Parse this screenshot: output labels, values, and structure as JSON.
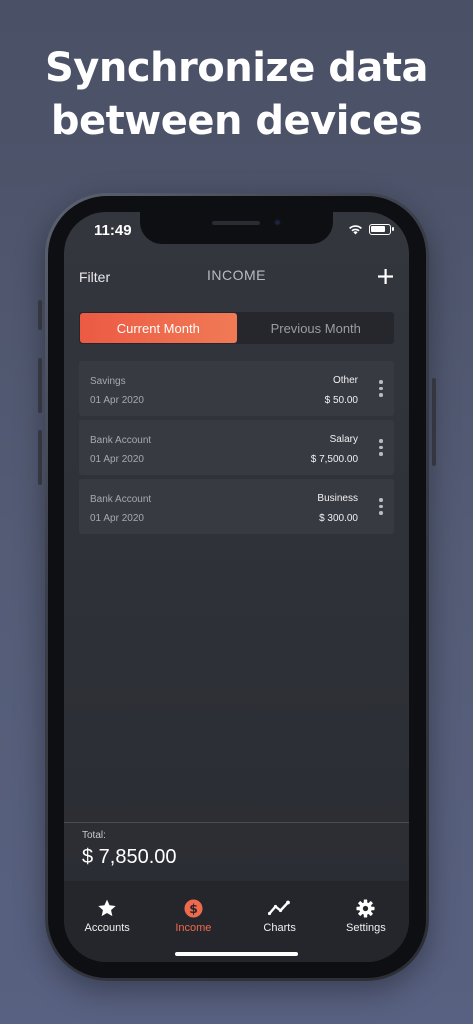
{
  "headline": {
    "line1": "Synchronize data",
    "line2": "between devices"
  },
  "status": {
    "time": "11:49"
  },
  "nav": {
    "left": "Filter",
    "title": "INCOME",
    "add_icon": "+"
  },
  "segment": {
    "options": [
      "Current Month",
      "Previous Month"
    ],
    "selected": "Current Month"
  },
  "entries": [
    {
      "account": "Savings",
      "date": "01 Apr 2020",
      "category": "Other",
      "amount": "$ 50.00"
    },
    {
      "account": "Bank Account",
      "date": "01 Apr 2020",
      "category": "Salary",
      "amount": "$ 7,500.00"
    },
    {
      "account": "Bank Account",
      "date": "01 Apr 2020",
      "category": "Business",
      "amount": "$ 300.00"
    }
  ],
  "total": {
    "label": "Total:",
    "value": "$ 7,850.00"
  },
  "tabs": [
    {
      "label": "Accounts",
      "icon": "star-icon"
    },
    {
      "label": "Income",
      "icon": "dollar-icon"
    },
    {
      "label": "Charts",
      "icon": "line-chart-icon"
    },
    {
      "label": "Settings",
      "icon": "gear-icon"
    }
  ],
  "active_tab": "Income",
  "colors": {
    "accent": "#ef6a4d",
    "background": "#4f566e",
    "screen": "#303238",
    "row": "#383a42"
  }
}
